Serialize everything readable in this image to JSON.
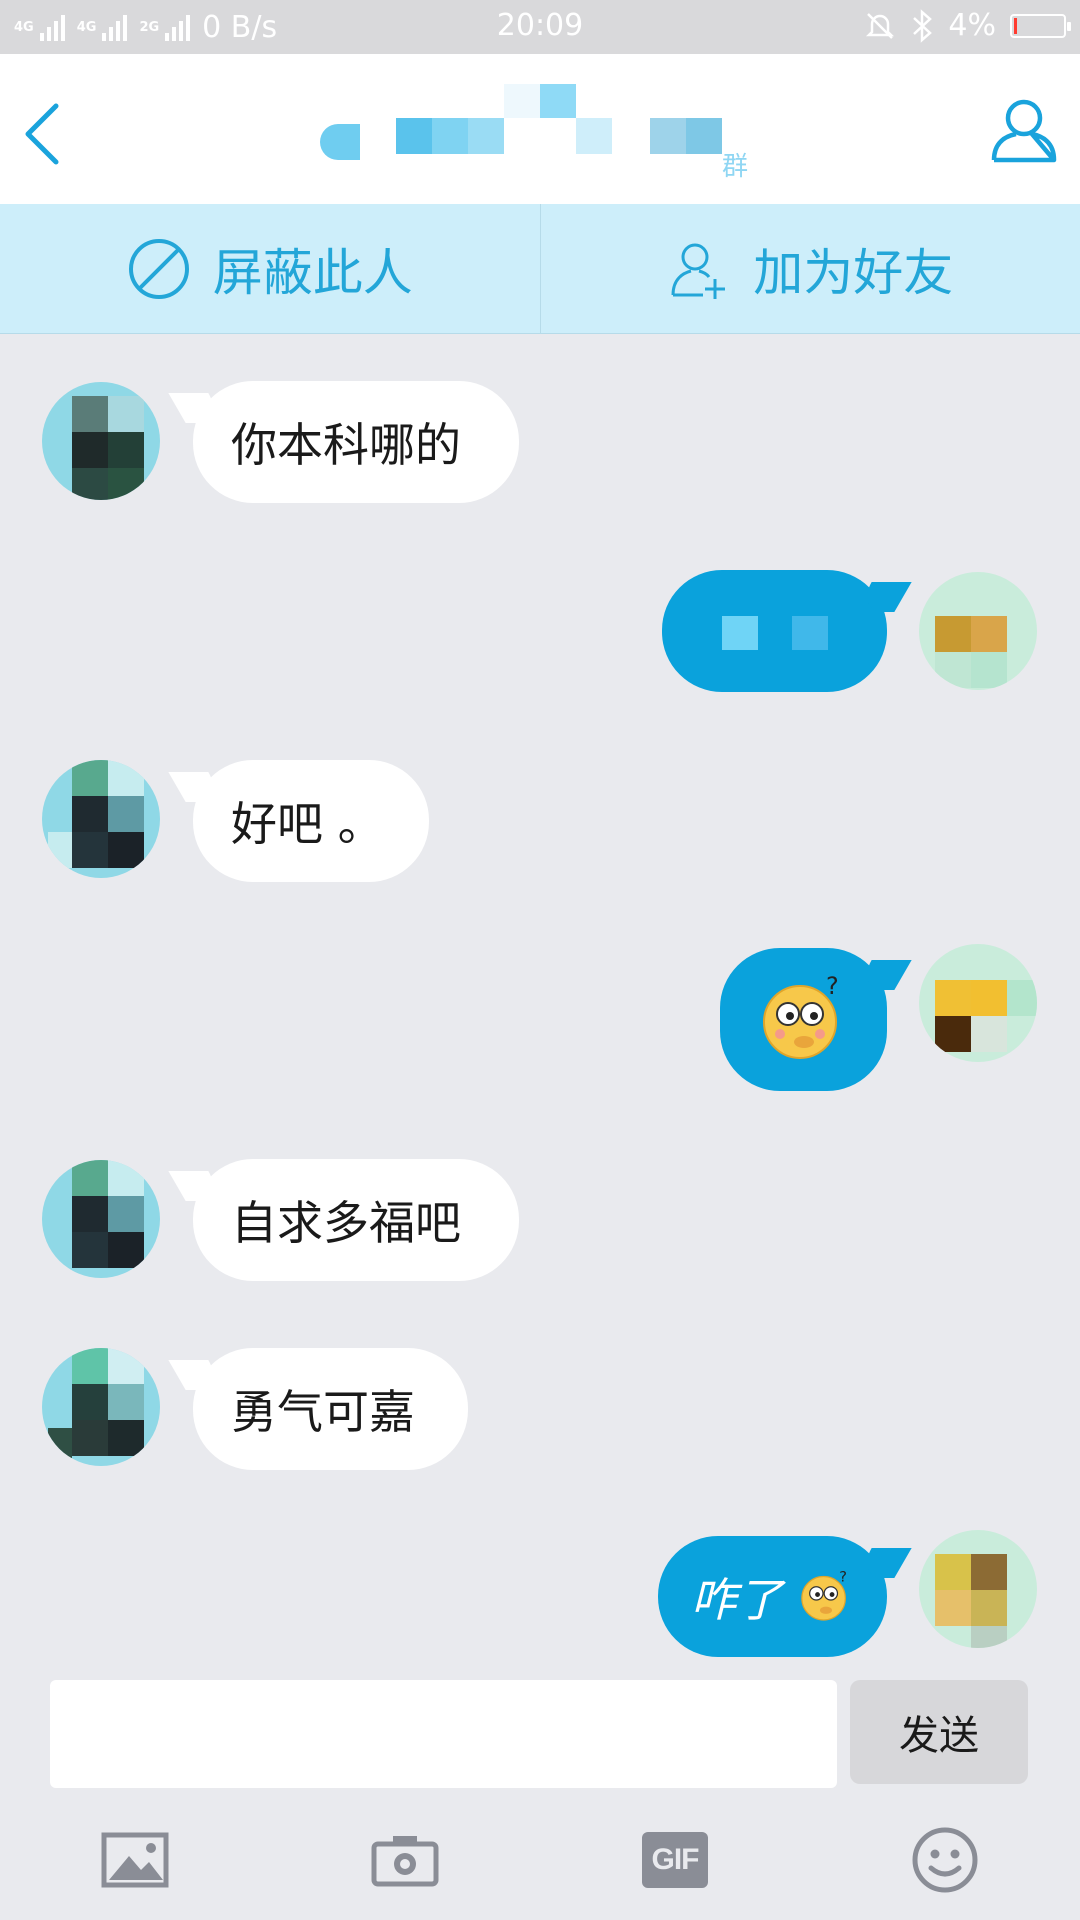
{
  "status_bar": {
    "network_1": "4G",
    "network_2": "4G",
    "network_3": "2G",
    "speed": "0 B/s",
    "time": "20:09",
    "battery": "4%"
  },
  "header": {
    "title_suffix": "群",
    "back_icon": "chevron-left-icon",
    "profile_icon": "user-icon"
  },
  "actions": {
    "block_label": "屏蔽此人",
    "add_friend_label": "加为好友"
  },
  "messages": [
    {
      "side": "in",
      "text": "你本科哪的"
    },
    {
      "side": "out",
      "text": ""
    },
    {
      "side": "in",
      "text": "好吧 。"
    },
    {
      "side": "out",
      "text": "",
      "emoji": "confused-face-emoji"
    },
    {
      "side": "in",
      "text": "自求多福吧"
    },
    {
      "side": "in",
      "text": "勇气可嘉"
    },
    {
      "side": "out",
      "text": "咋了",
      "emoji": "confused-face-emoji"
    }
  ],
  "composer": {
    "input_value": "",
    "send_label": "发送"
  },
  "toolbar": {
    "image_icon": "image-icon",
    "camera_icon": "camera-icon",
    "gif_label": "GIF",
    "emoji_icon": "smiley-icon"
  },
  "colors": {
    "accent": "#0aa2dc",
    "action_bar_bg": "#cdeefa",
    "action_text": "#23a6d8",
    "chat_bg": "#e9eaee"
  }
}
